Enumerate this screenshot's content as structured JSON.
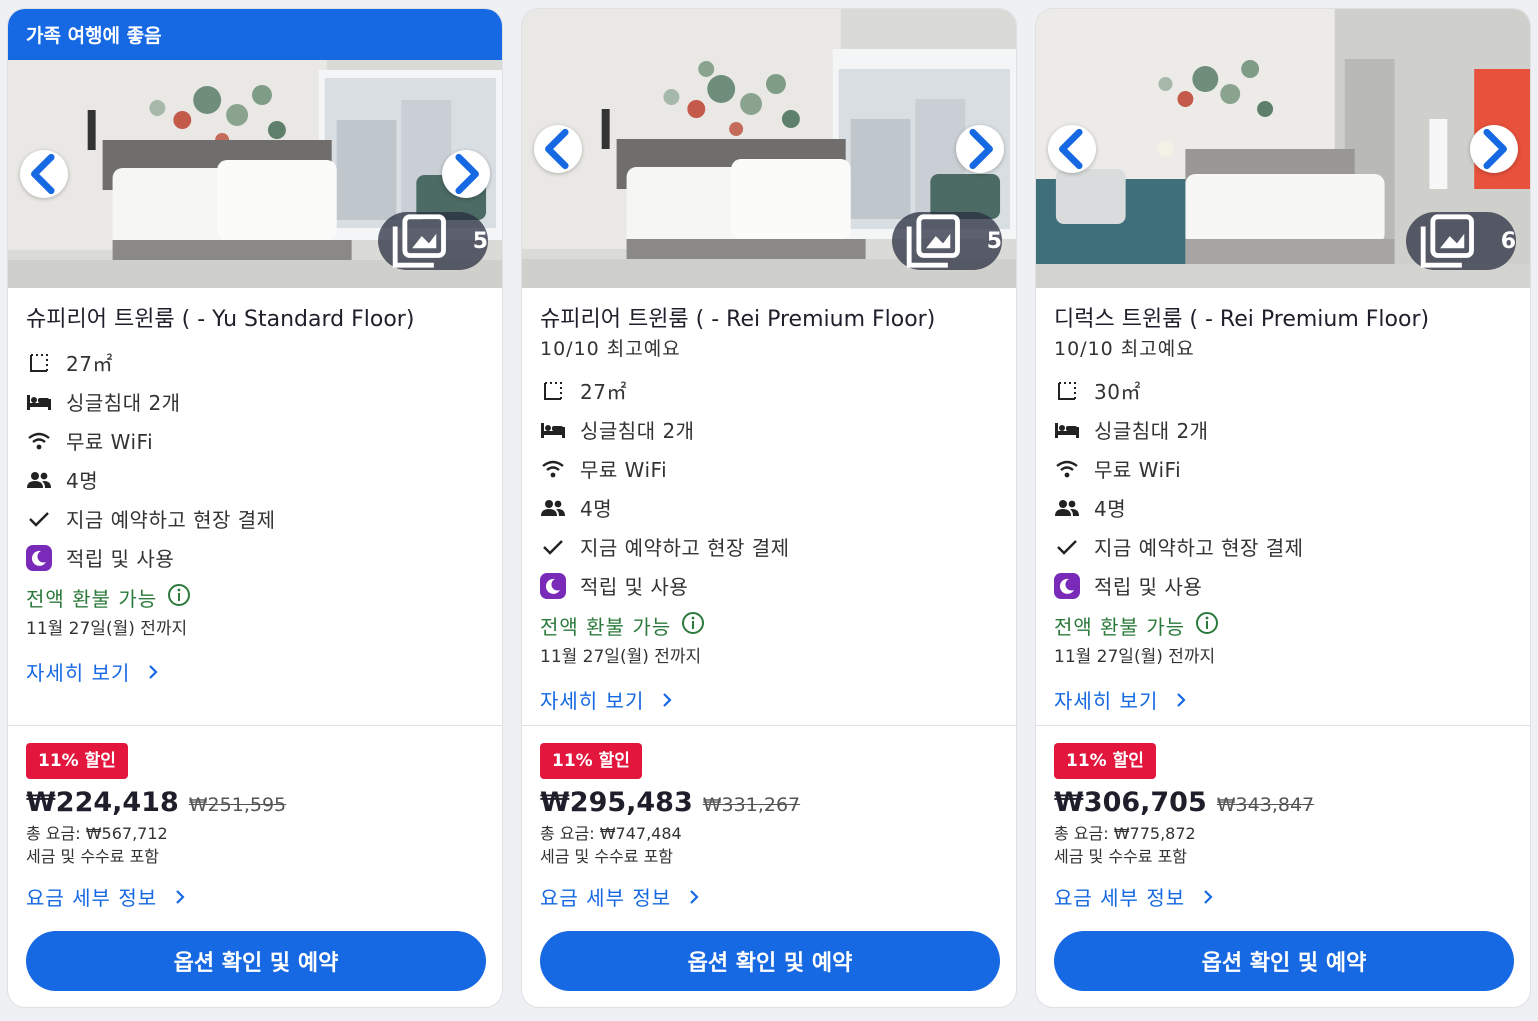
{
  "cards": [
    {
      "badge": "가족 여행에 좋음",
      "gallery_count": "5",
      "title": "슈피리어 트윈룸 ( - Yu Standard Floor)",
      "rating": "",
      "features": {
        "area": "27㎡",
        "beds": "싱글침대 2개",
        "wifi": "무료 WiFi",
        "guests": "4명",
        "pay": "지금 예약하고 현장 결제",
        "rewards": "적립 및 사용"
      },
      "refund": "전액 환불 가능",
      "refund_until": "11월 27일(월) 전까지",
      "more_link": "자세히 보기",
      "discount": "11% 할인",
      "price": "₩224,418",
      "original_price": "₩251,595",
      "total": "총 요금: ₩567,712",
      "tax_note": "세금 및 수수료 포함",
      "fee_link": "요금 세부 정보",
      "reserve_label": "옵션 확인 및 예약"
    },
    {
      "badge": "",
      "gallery_count": "5",
      "title": "슈피리어 트윈룸 ( - Rei Premium Floor)",
      "rating": "10/10 최고예요",
      "features": {
        "area": "27㎡",
        "beds": "싱글침대 2개",
        "wifi": "무료 WiFi",
        "guests": "4명",
        "pay": "지금 예약하고 현장 결제",
        "rewards": "적립 및 사용"
      },
      "refund": "전액 환불 가능",
      "refund_until": "11월 27일(월) 전까지",
      "more_link": "자세히 보기",
      "discount": "11% 할인",
      "price": "₩295,483",
      "original_price": "₩331,267",
      "total": "총 요금: ₩747,484",
      "tax_note": "세금 및 수수료 포함",
      "fee_link": "요금 세부 정보",
      "reserve_label": "옵션 확인 및 예약"
    },
    {
      "badge": "",
      "gallery_count": "6",
      "title": "디럭스 트윈룸 ( - Rei Premium Floor)",
      "rating": "10/10 최고예요",
      "features": {
        "area": "30㎡",
        "beds": "싱글침대 2개",
        "wifi": "무료 WiFi",
        "guests": "4명",
        "pay": "지금 예약하고 현장 결제",
        "rewards": "적립 및 사용"
      },
      "refund": "전액 환불 가능",
      "refund_until": "11월 27일(월) 전까지",
      "more_link": "자세히 보기",
      "discount": "11% 할인",
      "price": "₩306,705",
      "original_price": "₩343,847",
      "total": "총 요금: ₩775,872",
      "tax_note": "세금 및 수수료 포함",
      "fee_link": "요금 세부 정보",
      "reserve_label": "옵션 확인 및 예약"
    }
  ],
  "colors": {
    "accent": "#1668e3",
    "discount": "#e3173e",
    "refund": "#2b7a3b",
    "rewards_icon": "#7a2ab8"
  },
  "icons": [
    "chevron-left-icon",
    "chevron-right-icon",
    "gallery-icon",
    "area-icon",
    "bed-icon",
    "wifi-icon",
    "people-icon",
    "check-icon",
    "moon-icon",
    "info-icon"
  ]
}
